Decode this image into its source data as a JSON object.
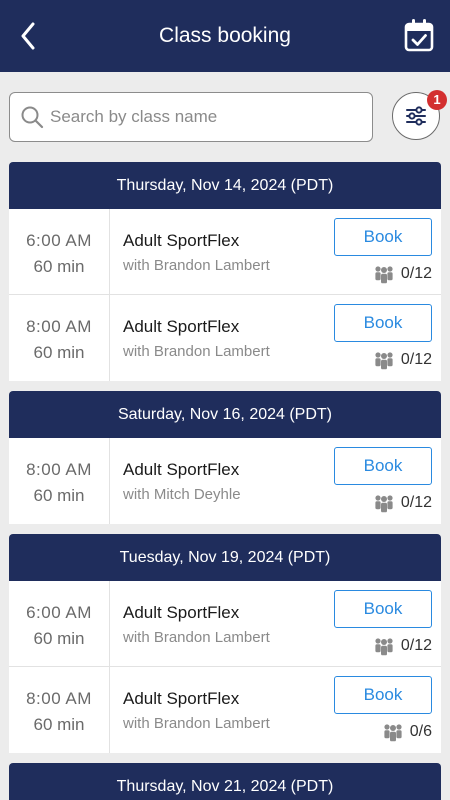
{
  "header": {
    "title": "Class booking",
    "back_icon": "chevron-left-icon",
    "calendar_icon": "calendar-check-icon"
  },
  "search": {
    "placeholder": "Search by class name",
    "value": ""
  },
  "filter": {
    "badge_count": "1"
  },
  "colors": {
    "nav": "#1f2d5c",
    "accent": "#2a8ae0",
    "badge": "#d32f2f"
  },
  "sections": [
    {
      "date": "Thursday, Nov 14, 2024 (PDT)",
      "classes": [
        {
          "time": "6:00  AM",
          "duration": "60 min",
          "name": "Adult SportFlex",
          "coach": "with Brandon Lambert",
          "book_label": "Book",
          "capacity": "0/12"
        },
        {
          "time": "8:00  AM",
          "duration": "60 min",
          "name": "Adult SportFlex",
          "coach": "with Brandon Lambert",
          "book_label": "Book",
          "capacity": "0/12"
        }
      ]
    },
    {
      "date": "Saturday, Nov 16, 2024 (PDT)",
      "classes": [
        {
          "time": "8:00  AM",
          "duration": "60 min",
          "name": "Adult SportFlex",
          "coach": "with Mitch Deyhle",
          "book_label": "Book",
          "capacity": "0/12"
        }
      ]
    },
    {
      "date": "Tuesday, Nov 19, 2024 (PDT)",
      "classes": [
        {
          "time": "6:00  AM",
          "duration": "60 min",
          "name": "Adult SportFlex",
          "coach": "with Brandon Lambert",
          "book_label": "Book",
          "capacity": "0/12"
        },
        {
          "time": "8:00  AM",
          "duration": "60 min",
          "name": "Adult SportFlex",
          "coach": "with Brandon Lambert",
          "book_label": "Book",
          "capacity": "0/6"
        }
      ]
    },
    {
      "date": "Thursday, Nov 21, 2024 (PDT)",
      "classes": []
    }
  ]
}
